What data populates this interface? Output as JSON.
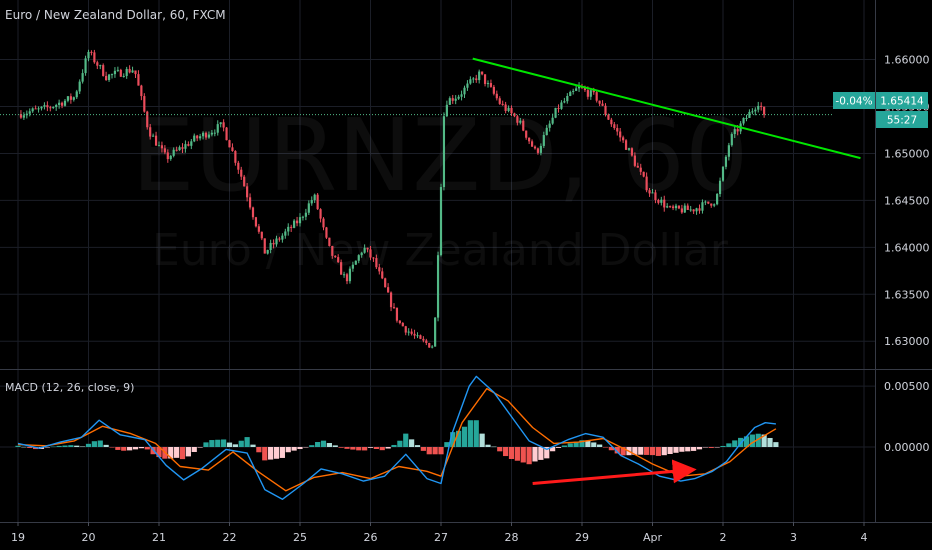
{
  "header": {
    "symbol_title": "Euro / New Zealand Dollar, 60, FXCM",
    "macd_title": "MACD (12, 26, close, 9)"
  },
  "watermark": {
    "ticker": "EURNZD, 60",
    "name": "Euro / New Zealand Dollar"
  },
  "price_axis": {
    "ticks": [
      "1.66000",
      "1.65500",
      "1.65000",
      "1.64500",
      "1.64000",
      "1.63500",
      "1.63000"
    ],
    "current_change": "-0.04%",
    "current_price": "1.65414",
    "countdown": "55:27"
  },
  "macd_axis": {
    "ticks": [
      "0.00500",
      "0.00000"
    ]
  },
  "time_axis": {
    "ticks": [
      "19",
      "20",
      "21",
      "22",
      "25",
      "26",
      "27",
      "28",
      "29",
      "Apr",
      "2",
      "3",
      "4"
    ]
  },
  "colors": {
    "up": "#53b987",
    "down": "#eb4d5c",
    "trendline": "#00e600",
    "arrow": "#ff1a1a",
    "macd_line": "#2196f3",
    "signal_line": "#ff6d00",
    "hist_pos_strong": "#26a69a",
    "hist_pos_weak": "#b2dfdb",
    "hist_neg_strong": "#ef5350",
    "hist_neg_weak": "#ffcdd2",
    "price_label_bg": "#26a69a"
  },
  "chart_data": [
    {
      "type": "candlestick",
      "title": "Euro / New Zealand Dollar, 60, FXCM",
      "x_days": [
        "19",
        "20",
        "21",
        "22",
        "25",
        "26",
        "27",
        "28",
        "29",
        "Apr",
        "2",
        "3",
        "4"
      ],
      "ylim": [
        1.628,
        1.664
      ],
      "yticks": [
        1.66,
        1.655,
        1.65,
        1.645,
        1.64,
        1.635,
        1.63
      ],
      "current_price": 1.65414,
      "close_path": [
        {
          "day": 0.0,
          "price": 1.6542
        },
        {
          "day": 0.4,
          "price": 1.6548
        },
        {
          "day": 0.8,
          "price": 1.656
        },
        {
          "day": 1.0,
          "price": 1.6608
        },
        {
          "day": 1.25,
          "price": 1.6582
        },
        {
          "day": 1.65,
          "price": 1.659
        },
        {
          "day": 1.85,
          "price": 1.6525
        },
        {
          "day": 2.1,
          "price": 1.6495
        },
        {
          "day": 2.5,
          "price": 1.6515
        },
        {
          "day": 2.9,
          "price": 1.653
        },
        {
          "day": 3.15,
          "price": 1.648
        },
        {
          "day": 3.5,
          "price": 1.6395
        },
        {
          "day": 4.0,
          "price": 1.643
        },
        {
          "day": 4.2,
          "price": 1.6455
        },
        {
          "day": 4.4,
          "price": 1.64
        },
        {
          "day": 4.65,
          "price": 1.6365
        },
        {
          "day": 4.9,
          "price": 1.64
        },
        {
          "day": 5.05,
          "price": 1.6385
        },
        {
          "day": 5.4,
          "price": 1.632
        },
        {
          "day": 5.7,
          "price": 1.63
        },
        {
          "day": 5.9,
          "price": 1.6295
        },
        {
          "day": 6.05,
          "price": 1.6555
        },
        {
          "day": 6.25,
          "price": 1.6562
        },
        {
          "day": 6.55,
          "price": 1.6585
        },
        {
          "day": 6.85,
          "price": 1.6552
        },
        {
          "day": 7.1,
          "price": 1.6535
        },
        {
          "day": 7.35,
          "price": 1.65
        },
        {
          "day": 7.65,
          "price": 1.6548
        },
        {
          "day": 7.95,
          "price": 1.657
        },
        {
          "day": 8.2,
          "price": 1.656
        },
        {
          "day": 8.45,
          "price": 1.6528
        },
        {
          "day": 8.65,
          "price": 1.6505
        },
        {
          "day": 8.95,
          "price": 1.646
        },
        {
          "day": 9.25,
          "price": 1.644
        },
        {
          "day": 9.55,
          "price": 1.644
        },
        {
          "day": 9.9,
          "price": 1.645
        },
        {
          "day": 10.1,
          "price": 1.6515
        },
        {
          "day": 10.3,
          "price": 1.6535
        },
        {
          "day": 10.5,
          "price": 1.6555
        },
        {
          "day": 10.6,
          "price": 1.65414
        }
      ],
      "annotations": [
        {
          "type": "trendline",
          "from": {
            "day": 6.45,
            "price": 1.6601
          },
          "to": {
            "day": 11.95,
            "price": 1.6495
          }
        }
      ]
    },
    {
      "type": "macd",
      "title": "MACD (12, 26, close, 9)",
      "ylim": [
        -0.006,
        0.006
      ],
      "yticks": [
        0.005,
        0.0
      ],
      "macd": [
        {
          "day": 0.0,
          "value": 0.0003
        },
        {
          "day": 0.3,
          "value": -0.0001
        },
        {
          "day": 0.6,
          "value": 0.0004
        },
        {
          "day": 0.9,
          "value": 0.0008
        },
        {
          "day": 1.15,
          "value": 0.0022
        },
        {
          "day": 1.45,
          "value": 0.001
        },
        {
          "day": 1.8,
          "value": 0.0006
        },
        {
          "day": 2.1,
          "value": -0.0015
        },
        {
          "day": 2.35,
          "value": -0.0027
        },
        {
          "day": 2.6,
          "value": -0.0018
        },
        {
          "day": 2.95,
          "value": -0.0002
        },
        {
          "day": 3.25,
          "value": -0.0005
        },
        {
          "day": 3.5,
          "value": -0.0035
        },
        {
          "day": 3.75,
          "value": -0.0043
        },
        {
          "day": 4.05,
          "value": -0.003
        },
        {
          "day": 4.3,
          "value": -0.0018
        },
        {
          "day": 4.6,
          "value": -0.0022
        },
        {
          "day": 4.9,
          "value": -0.0028
        },
        {
          "day": 5.2,
          "value": -0.0024
        },
        {
          "day": 5.5,
          "value": -0.0006
        },
        {
          "day": 5.8,
          "value": -0.0026
        },
        {
          "day": 6.0,
          "value": -0.003
        },
        {
          "day": 6.15,
          "value": 0.001
        },
        {
          "day": 6.4,
          "value": 0.005
        },
        {
          "day": 6.5,
          "value": 0.0058
        },
        {
          "day": 6.75,
          "value": 0.0045
        },
        {
          "day": 7.0,
          "value": 0.0025
        },
        {
          "day": 7.25,
          "value": 0.0005
        },
        {
          "day": 7.5,
          "value": -0.0002
        },
        {
          "day": 7.8,
          "value": 0.0006
        },
        {
          "day": 8.05,
          "value": 0.0011
        },
        {
          "day": 8.3,
          "value": 0.0008
        },
        {
          "day": 8.55,
          "value": -0.0007
        },
        {
          "day": 8.8,
          "value": -0.0014
        },
        {
          "day": 9.1,
          "value": -0.0024
        },
        {
          "day": 9.4,
          "value": -0.0028
        },
        {
          "day": 9.6,
          "value": -0.0026
        },
        {
          "day": 9.85,
          "value": -0.002
        },
        {
          "day": 10.05,
          "value": -0.0012
        },
        {
          "day": 10.25,
          "value": 0.0003
        },
        {
          "day": 10.45,
          "value": 0.0016
        },
        {
          "day": 10.6,
          "value": 0.002
        },
        {
          "day": 10.75,
          "value": 0.0019
        }
      ],
      "signal": [
        {
          "day": 0.0,
          "value": 0.0002
        },
        {
          "day": 0.4,
          "value": 0.0001
        },
        {
          "day": 0.8,
          "value": 0.0005
        },
        {
          "day": 1.2,
          "value": 0.0017
        },
        {
          "day": 1.6,
          "value": 0.0011
        },
        {
          "day": 1.95,
          "value": 0.0003
        },
        {
          "day": 2.3,
          "value": -0.0016
        },
        {
          "day": 2.7,
          "value": -0.0019
        },
        {
          "day": 3.05,
          "value": -0.0004
        },
        {
          "day": 3.4,
          "value": -0.002
        },
        {
          "day": 3.8,
          "value": -0.0036
        },
        {
          "day": 4.2,
          "value": -0.0025
        },
        {
          "day": 4.6,
          "value": -0.0021
        },
        {
          "day": 5.0,
          "value": -0.0026
        },
        {
          "day": 5.4,
          "value": -0.0016
        },
        {
          "day": 5.8,
          "value": -0.002
        },
        {
          "day": 6.0,
          "value": -0.0024
        },
        {
          "day": 6.3,
          "value": 0.002
        },
        {
          "day": 6.65,
          "value": 0.0048
        },
        {
          "day": 6.95,
          "value": 0.0038
        },
        {
          "day": 7.3,
          "value": 0.0016
        },
        {
          "day": 7.6,
          "value": 0.0003
        },
        {
          "day": 7.95,
          "value": 0.0004
        },
        {
          "day": 8.3,
          "value": 0.0007
        },
        {
          "day": 8.65,
          "value": -0.0003
        },
        {
          "day": 9.0,
          "value": -0.0014
        },
        {
          "day": 9.4,
          "value": -0.0024
        },
        {
          "day": 9.75,
          "value": -0.0022
        },
        {
          "day": 10.1,
          "value": -0.0012
        },
        {
          "day": 10.4,
          "value": 0.0003
        },
        {
          "day": 10.75,
          "value": 0.0015
        }
      ],
      "annotations": [
        {
          "type": "arrow",
          "from": {
            "day": 7.3,
            "value": -0.003
          },
          "to": {
            "day": 9.5,
            "value": -0.0019
          }
        }
      ]
    }
  ]
}
